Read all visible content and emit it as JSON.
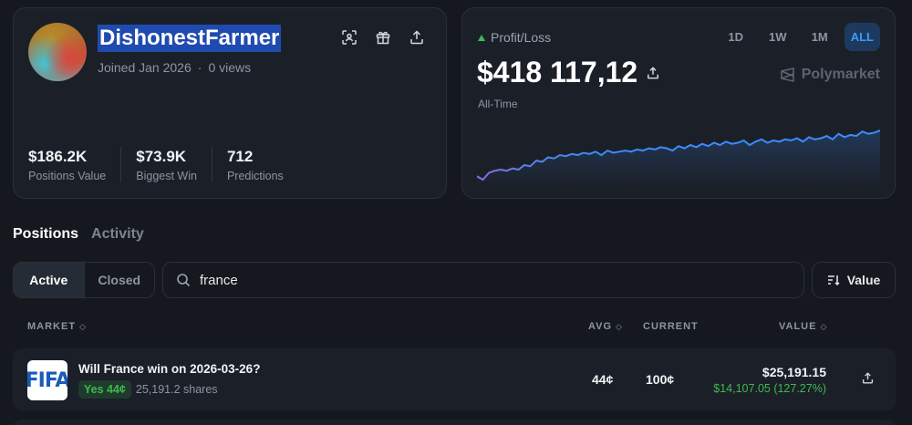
{
  "profile": {
    "username": "DishonestFarmer",
    "joined": "Joined Jan 2026",
    "separator": "·",
    "views": "0 views",
    "stats": [
      {
        "value": "$186.2K",
        "label": "Positions Value"
      },
      {
        "value": "$73.9K",
        "label": "Biggest Win"
      },
      {
        "value": "712",
        "label": "Predictions"
      }
    ]
  },
  "pnl": {
    "label": "Profit/Loss",
    "value": "$418 117,12",
    "period": "All-Time",
    "brand": "Polymarket",
    "ranges": [
      "1D",
      "1W",
      "1M",
      "ALL"
    ],
    "active_range": "ALL",
    "colors": {
      "line": "#3b8cff",
      "line_start": "#8e6bd8",
      "up": "#3fb950"
    }
  },
  "chart_data": {
    "type": "line",
    "series": [
      {
        "values": [
          8,
          5,
          11,
          13,
          14,
          13,
          15,
          14,
          18,
          17,
          22,
          21,
          25,
          24,
          27,
          26,
          28,
          27,
          29,
          28,
          30,
          27,
          31,
          29,
          30,
          31,
          30,
          32,
          31,
          33,
          32,
          34,
          33,
          31,
          35,
          33,
          36,
          34,
          37,
          35,
          38,
          36,
          39,
          37,
          38,
          40,
          36,
          39,
          41,
          38,
          40,
          39,
          41,
          40,
          42,
          39,
          43,
          41,
          42,
          44,
          41,
          46,
          43,
          45,
          44,
          48,
          46,
          47,
          49
        ]
      }
    ]
  },
  "tabs": [
    {
      "label": "Positions"
    },
    {
      "label": "Activity"
    }
  ],
  "filters": {
    "active_label": "Active",
    "closed_label": "Closed",
    "search_value": "france",
    "sort_label": "Value"
  },
  "table": {
    "headers": {
      "market": "MARKET",
      "avg": "AVG",
      "current": "CURRENT",
      "value": "VALUE"
    },
    "rows": [
      {
        "logo": "FIFA",
        "title": "Will France win on 2026-03-26?",
        "outcome": "Yes 44¢",
        "shares": "25,191.2 shares",
        "avg": "44¢",
        "current": "100¢",
        "value": "$25,191.15",
        "pnl": "$14,107.05 (127.27%)"
      }
    ]
  }
}
